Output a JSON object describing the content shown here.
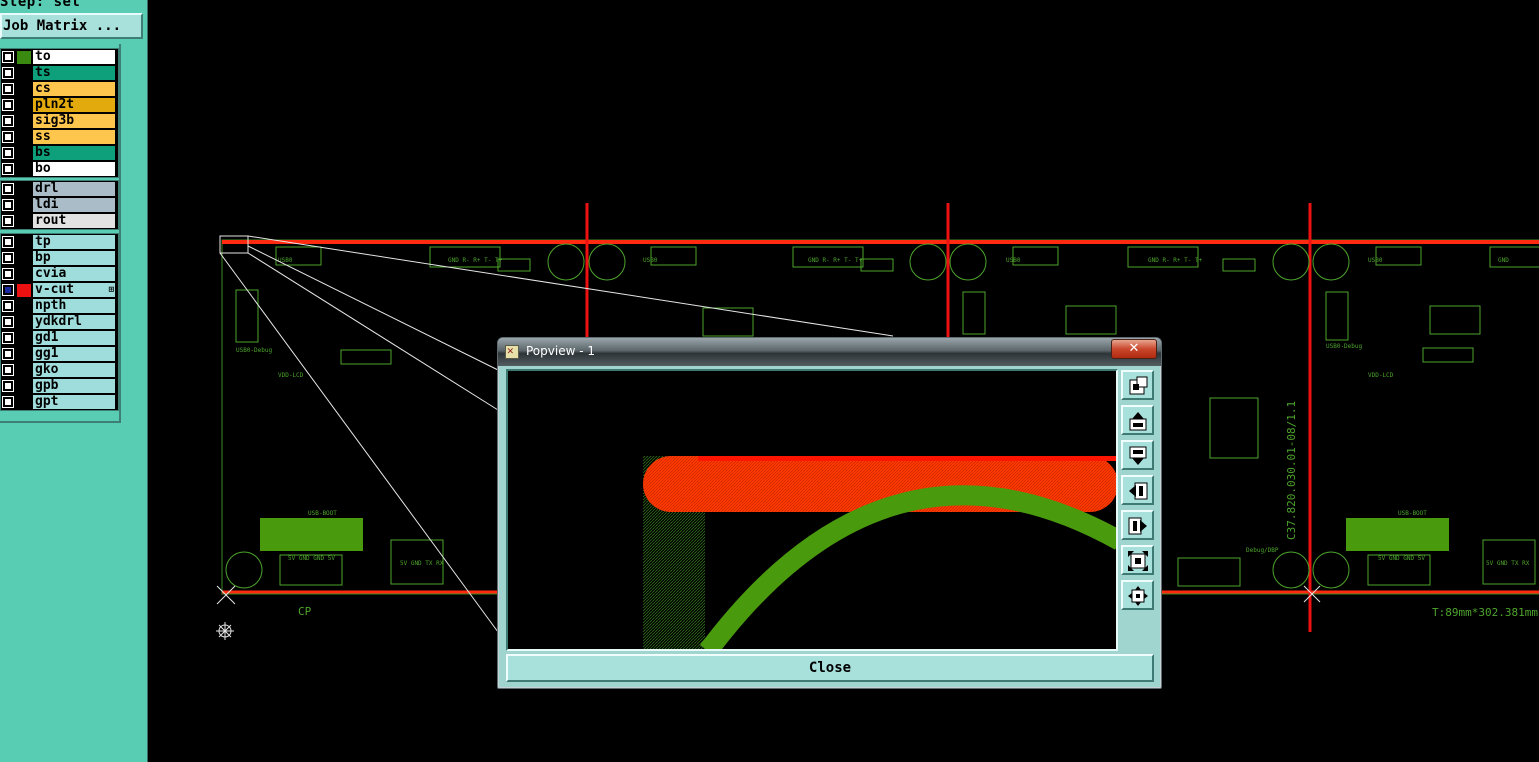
{
  "left_panel": {
    "step_label": "Step: set",
    "job_matrix_button": "Job Matrix ...",
    "layer_groups": [
      [
        {
          "name": "to",
          "color": "#ffffff",
          "swatch": "#3a8a12",
          "checked": false
        },
        {
          "name": "ts",
          "color": "#0ea07a",
          "swatch": "#000000",
          "checked": false
        },
        {
          "name": "cs",
          "color": "#ffc64d",
          "swatch": "#000000",
          "checked": false
        },
        {
          "name": "pln2t",
          "color": "#e2aa0d",
          "swatch": "#000000",
          "checked": false
        },
        {
          "name": "sig3b",
          "color": "#ffc64d",
          "swatch": "#000000",
          "checked": false
        },
        {
          "name": "ss",
          "color": "#ffc64d",
          "swatch": "#000000",
          "checked": false
        },
        {
          "name": "bs",
          "color": "#0ea07a",
          "swatch": "#000000",
          "checked": false
        },
        {
          "name": "bo",
          "color": "#ffffff",
          "swatch": "#000000",
          "checked": false
        }
      ],
      [
        {
          "name": "drl",
          "color": "#a9bcc7",
          "swatch": "#000000",
          "checked": false
        },
        {
          "name": "ldi",
          "color": "#a9bcc7",
          "swatch": "#000000",
          "checked": false
        },
        {
          "name": "rout",
          "color": "#e2e2e2",
          "swatch": "#000000",
          "checked": false
        }
      ],
      [
        {
          "name": "tp",
          "color": "#9fdcdc",
          "swatch": "#000000",
          "checked": false
        },
        {
          "name": "bp",
          "color": "#9fdcdc",
          "swatch": "#000000",
          "checked": false
        },
        {
          "name": "cvia",
          "color": "#9fdcdc",
          "swatch": "#000000",
          "checked": false
        },
        {
          "name": "v-cut",
          "color": "#9fdcdc",
          "swatch": "#ee1111",
          "checked": true,
          "mark": "⊞"
        },
        {
          "name": "npth",
          "color": "#9fdcdc",
          "swatch": "#000000",
          "checked": false
        },
        {
          "name": "ydkdrl",
          "color": "#9fdcdc",
          "swatch": "#000000",
          "checked": false
        },
        {
          "name": "gd1",
          "color": "#9fdcdc",
          "swatch": "#000000",
          "checked": false
        },
        {
          "name": "gg1",
          "color": "#9fdcdc",
          "swatch": "#000000",
          "checked": false
        },
        {
          "name": "gko",
          "color": "#9fdcdc",
          "swatch": "#000000",
          "checked": false
        },
        {
          "name": "gpb",
          "color": "#9fdcdc",
          "swatch": "#000000",
          "checked": false
        },
        {
          "name": "gpt",
          "color": "#9fdcdc",
          "swatch": "#000000",
          "checked": false
        }
      ]
    ]
  },
  "canvas": {
    "colors": {
      "background": "#000000",
      "outline": "#ff2a10",
      "silkscreen": "#4da42c",
      "vcut": "#ee1111"
    },
    "board_texts": {
      "dimension": "T:89mm*302.381mm",
      "panel_id": "C37.820.030.01-08/1.1",
      "corner_mark": "CP"
    }
  },
  "popview": {
    "title": "Popview - 1",
    "close_x": "✕",
    "close_button": "Close",
    "tools": [
      "zoom-fit-icon",
      "pan-up-icon",
      "pan-down-icon",
      "pan-left-icon",
      "pan-right-icon",
      "zoom-out-icon",
      "zoom-home-icon"
    ],
    "colors": {
      "red_layer": "#ff2200",
      "green_layer": "#4a9a0e"
    }
  }
}
